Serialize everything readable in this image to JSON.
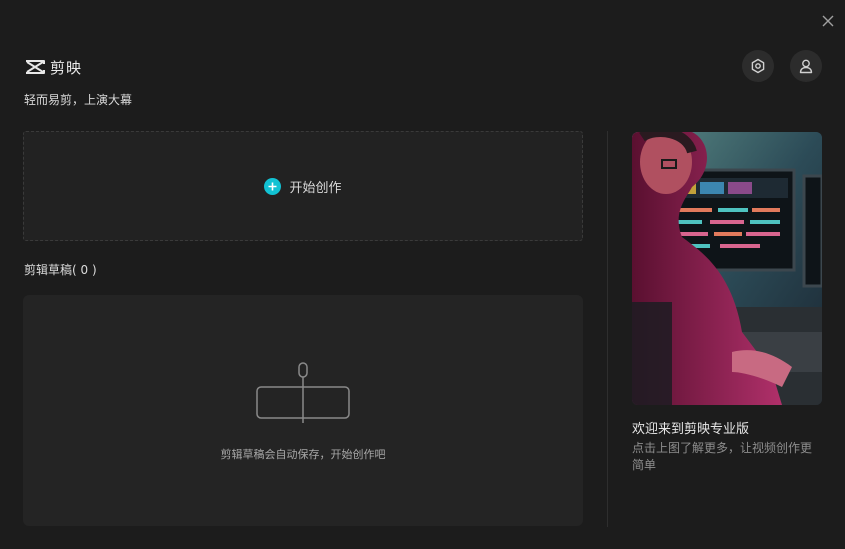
{
  "app": {
    "logo_text": "剪映",
    "slogan": "轻而易剪，上演大幕"
  },
  "header": {
    "settings_icon": "hexagon-settings-icon",
    "user_icon": "user-icon",
    "close_icon": "close-icon"
  },
  "create": {
    "label": "开始创作",
    "accent_color": "#12c2d3"
  },
  "drafts": {
    "title": "剪辑草稿",
    "count_text": "( 0 )",
    "empty_text": "剪辑草稿会自动保存，开始创作吧"
  },
  "promo": {
    "title": "欢迎来到剪映专业版",
    "description": "点击上图了解更多，让视频创作更简单"
  }
}
